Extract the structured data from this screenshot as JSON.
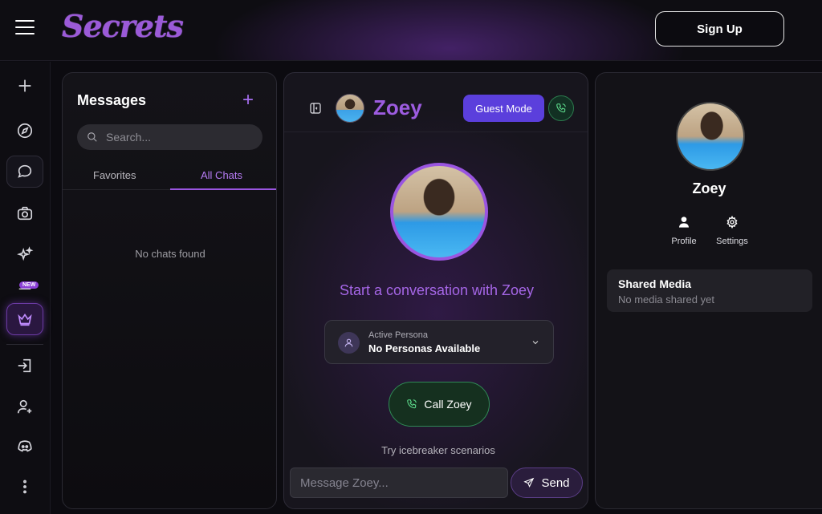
{
  "app": {
    "logo": "Secrets",
    "signup_label": "Sign Up"
  },
  "rail": {
    "new_badge": "NEW"
  },
  "messages": {
    "title": "Messages",
    "add_symbol": "+",
    "search_placeholder": "Search...",
    "tabs": [
      {
        "label": "Favorites"
      },
      {
        "label": "All Chats"
      }
    ],
    "empty_text": "No chats found"
  },
  "chat": {
    "name": "Zoey",
    "guest_mode_label": "Guest Mode",
    "start_text": "Start a conversation with Zoey",
    "persona": {
      "label": "Active Persona",
      "value": "No Personas Available"
    },
    "call_label": "Call Zoey",
    "icebreaker_text": "Try icebreaker scenarios",
    "input_placeholder": "Message Zoey...",
    "send_label": "Send"
  },
  "profile": {
    "name": "Zoey",
    "actions": [
      {
        "label": "Profile"
      },
      {
        "label": "Settings"
      }
    ],
    "shared_media": {
      "title": "Shared Media",
      "empty_text": "No media shared yet"
    }
  },
  "colors": {
    "accent": "#9a55e0",
    "call_green": "#2f8a55",
    "guest_blue": "#5b3fdc"
  }
}
